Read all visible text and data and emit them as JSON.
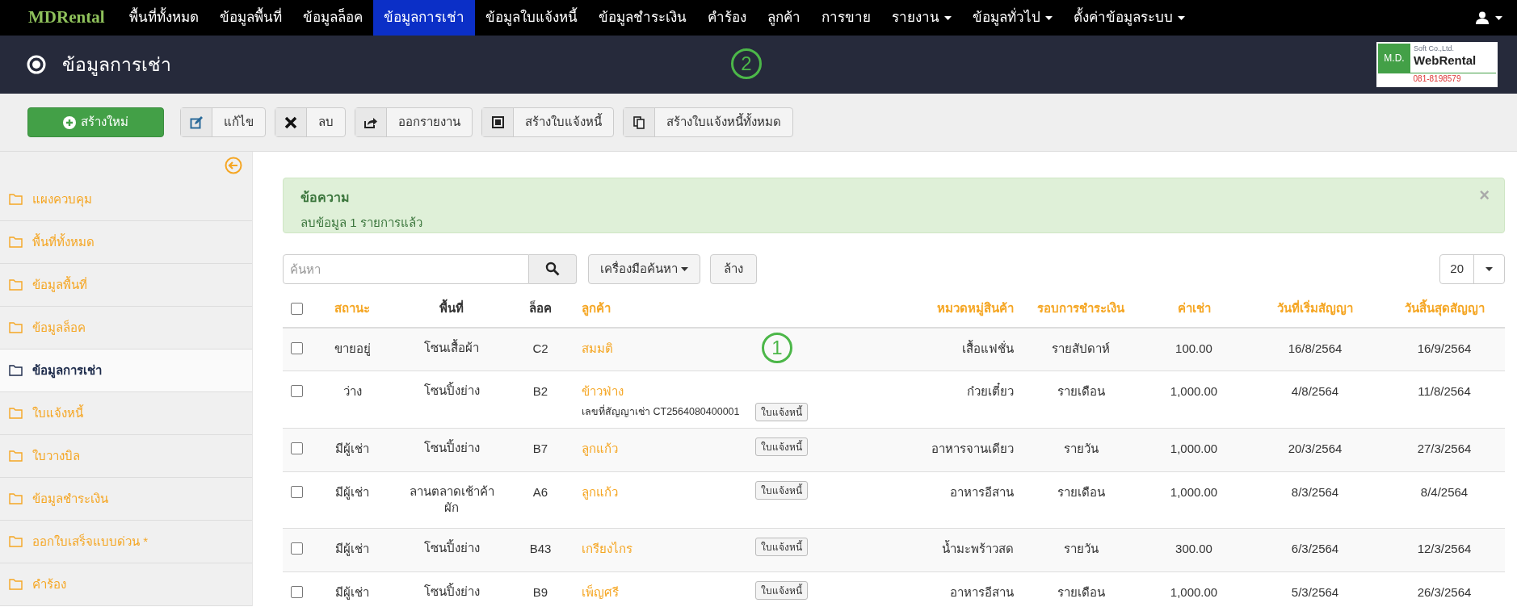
{
  "navbar": {
    "brand": "MDRental",
    "items": [
      {
        "label": "พื้นที่ทั้งหมด",
        "selected": false,
        "dropdown": false
      },
      {
        "label": "ข้อมูลพื้นที่",
        "selected": false,
        "dropdown": false
      },
      {
        "label": "ข้อมูลล็อค",
        "selected": false,
        "dropdown": false
      },
      {
        "label": "ข้อมูลการเช่า",
        "selected": true,
        "dropdown": false
      },
      {
        "label": "ข้อมูลใบแจ้งหนี้",
        "selected": false,
        "dropdown": false
      },
      {
        "label": "ข้อมูลชำระเงิน",
        "selected": false,
        "dropdown": false
      },
      {
        "label": "คำร้อง",
        "selected": false,
        "dropdown": false
      },
      {
        "label": "ลูกค้า",
        "selected": false,
        "dropdown": false
      },
      {
        "label": "การขาย",
        "selected": false,
        "dropdown": false
      },
      {
        "label": "รายงาน",
        "selected": false,
        "dropdown": true
      },
      {
        "label": "ข้อมูลทั่วไป",
        "selected": false,
        "dropdown": true
      },
      {
        "label": "ตั้งค่าข้อมูลระบบ",
        "selected": false,
        "dropdown": true
      }
    ]
  },
  "header": {
    "title": "ข้อมูลการเช่า",
    "logo": {
      "left": "M.D.",
      "company": "Soft Co.,Ltd.",
      "name": "WebRental",
      "phone": "081-8198579"
    }
  },
  "toolbar": [
    {
      "label": "สร้างใหม่",
      "kind": "primary"
    },
    {
      "label": "แก้ไข",
      "kind": "default"
    },
    {
      "label": "ลบ",
      "kind": "default"
    },
    {
      "label": "ออกรายงาน",
      "kind": "default"
    },
    {
      "label": "สร้างใบแจ้งหนี้",
      "kind": "default"
    },
    {
      "label": "สร้างใบแจ้งหนี้ทั้งหมด",
      "kind": "default"
    }
  ],
  "sidebar": {
    "items": [
      {
        "label": "แผงควบคุม",
        "selected": false
      },
      {
        "label": "พื้นที่ทั้งหมด",
        "selected": false
      },
      {
        "label": "ข้อมูลพื้นที่",
        "selected": false
      },
      {
        "label": "ข้อมูลล็อค",
        "selected": false
      },
      {
        "label": "ข้อมูลการเช่า",
        "selected": true
      },
      {
        "label": "ใบแจ้งหนี้",
        "selected": false
      },
      {
        "label": "ใบวางบิล",
        "selected": false
      },
      {
        "label": "ข้อมูลชำระเงิน",
        "selected": false
      },
      {
        "label": "ออกใบเสร็จแบบด่วน *",
        "selected": false
      },
      {
        "label": "คำร้อง",
        "selected": false
      }
    ]
  },
  "alert": {
    "title": "ข้อความ",
    "message": "ลบข้อมูล 1 รายการแล้ว",
    "close": "×"
  },
  "search": {
    "placeholder": "ค้นหา",
    "tools_button": "เครื่องมือค้นหา",
    "clear_button": "ล้าง",
    "page_size": "20"
  },
  "table": {
    "all_checked": false,
    "columns": [
      {
        "label": "สถานะ",
        "sortable": true
      },
      {
        "label": "พื้นที่",
        "sortable": false
      },
      {
        "label": "ล็อค",
        "sortable": false
      },
      {
        "label": "ลูกค้า",
        "sortable": true
      },
      {
        "label": "หมวดหมู่สินค้า",
        "sortable": true
      },
      {
        "label": "รอบการชำระเงิน",
        "sortable": true
      },
      {
        "label": "ค่าเช่า",
        "sortable": true
      },
      {
        "label": "วันที่เริ่มสัญญา",
        "sortable": true
      },
      {
        "label": "วันสิ้นสุดสัญญา",
        "sortable": true
      }
    ],
    "rows": [
      {
        "checked": false,
        "status": "ขายอยู่",
        "zone": "โซนเสื้อผ้า",
        "lot": "C2",
        "customer": "สมมติ",
        "category": "เสื้อแฟชั่น",
        "cycle": "รายสัปดาห์",
        "rent": "100.00",
        "start": "16/8/2564",
        "end": "16/9/2564"
      },
      {
        "checked": false,
        "status": "ว่าง",
        "zone": "โซนปิ้งย่าง",
        "lot": "B2",
        "customer": "ข้าวฟ่าง",
        "contract": "เลขที่สัญญาเช่า CT2564080400001",
        "invoice_button": "ใบแจ้งหนี้",
        "category": "ก๋วยเตี๋ยว",
        "cycle": "รายเดือน",
        "rent": "1,000.00",
        "start": "4/8/2564",
        "end": "11/8/2564"
      },
      {
        "checked": false,
        "status": "มีผู้เช่า",
        "zone": "โซนปิ้งย่าง",
        "lot": "B7",
        "customer": "ลูกแก้ว",
        "invoice_button": "ใบแจ้งหนี้",
        "category": "อาหารจานเดียว",
        "cycle": "รายวัน",
        "rent": "1,000.00",
        "start": "20/3/2564",
        "end": "27/3/2564"
      },
      {
        "checked": false,
        "status": "มีผู้เช่า",
        "zone": "ลานตลาดเช้าค้าผัก",
        "lot": "A6",
        "customer": "ลูกแก้ว",
        "invoice_button": "ใบแจ้งหนี้",
        "category": "อาหารอีสาน",
        "cycle": "รายเดือน",
        "rent": "1,000.00",
        "start": "8/3/2564",
        "end": "8/4/2564"
      },
      {
        "checked": false,
        "status": "มีผู้เช่า",
        "zone": "โซนปิ้งย่าง",
        "lot": "B43",
        "customer": "เกรียงไกร",
        "invoice_button": "ใบแจ้งหนี้",
        "category": "น้ำมะพร้าวสด",
        "cycle": "รายวัน",
        "rent": "300.00",
        "start": "6/3/2564",
        "end": "12/3/2564"
      },
      {
        "checked": false,
        "status": "มีผู้เช่า",
        "zone": "โซนปิ้งย่าง",
        "lot": "B9",
        "customer": "เพ็ญศรี",
        "invoice_button": "ใบแจ้งหนี้",
        "category": "อาหารอีสาน",
        "cycle": "รายเดือน",
        "rent": "1,000.00",
        "start": "5/3/2564",
        "end": "26/3/2564"
      }
    ]
  },
  "callouts": [
    {
      "number": "1"
    },
    {
      "number": "2"
    }
  ]
}
